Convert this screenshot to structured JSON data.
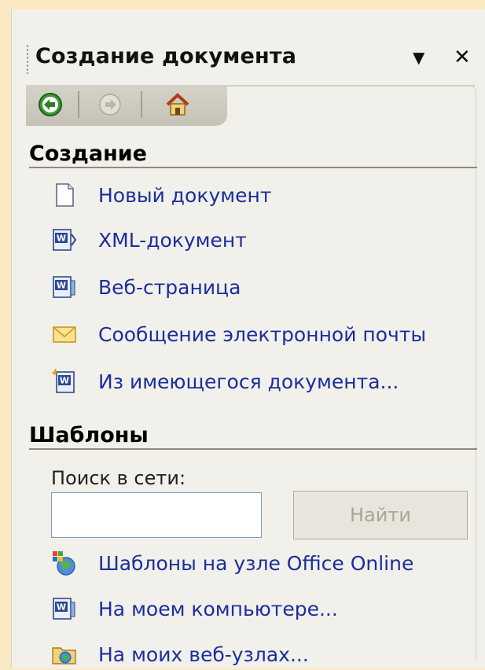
{
  "pane": {
    "title": "Создание документа",
    "menu_icon": "▼",
    "close_icon": "✕"
  },
  "nav": {
    "back": "back-arrow-icon",
    "forward": "forward-arrow-icon",
    "home": "home-icon"
  },
  "create_section": {
    "title": "Создание",
    "items": [
      {
        "label": "Новый документ",
        "icon": "blank-document-icon"
      },
      {
        "label": "XML-документ",
        "icon": "xml-document-icon"
      },
      {
        "label": "Веб-страница",
        "icon": "web-page-icon"
      },
      {
        "label": "Сообщение электронной почты",
        "icon": "envelope-icon"
      },
      {
        "label": "Из имеющегося документа...",
        "icon": "existing-document-icon"
      }
    ]
  },
  "templates_section": {
    "title": "Шаблоны",
    "search_label": "Поиск в сети:",
    "search_value": "",
    "find_button": "Найти",
    "items": [
      {
        "label": "Шаблоны на узле Office Online",
        "icon": "office-online-icon"
      },
      {
        "label": "На моем компьютере...",
        "icon": "word-document-icon"
      },
      {
        "label": "На моих веб-узлах...",
        "icon": "web-folder-icon"
      }
    ]
  }
}
